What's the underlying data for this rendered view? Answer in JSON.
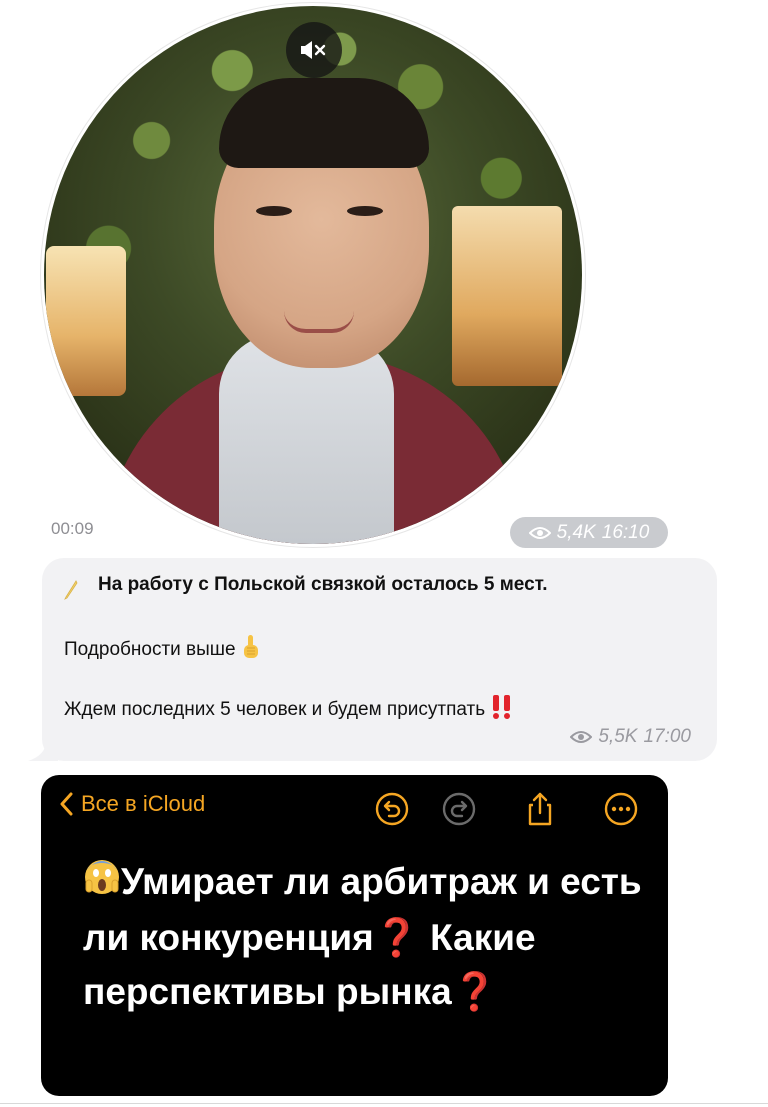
{
  "video_message": {
    "duration": "00:09",
    "views": "5,4K",
    "time": "16:10",
    "mute_icon": "speaker-muted-icon"
  },
  "text_message": {
    "line1": "На работу с Польской связкой осталось 5 мест.",
    "line2": "Подробности выше",
    "line2_emoji": "☝",
    "line3": "Ждем последних 5 человек и будем присутпать",
    "line3_emoji": "‼",
    "views": "5,5K",
    "time": "17:00",
    "leading_icon": "pencil-icon"
  },
  "notes_screenshot": {
    "back_label": "Все в iCloud",
    "toolbar_icons": [
      "undo-icon",
      "redo-icon",
      "share-icon",
      "more-icon"
    ],
    "title_emoji": "😱",
    "title_part1": "Умирает ли арбитраж и есть ли конкуренция",
    "title_part2": "Какие перспективы рынка",
    "question_mark": "❓"
  },
  "colors": {
    "accent_orange": "#f5a623",
    "question_red": "#e2242c",
    "bubble_bg": "#f2f2f4",
    "meta_gray": "#9a9aa0"
  }
}
